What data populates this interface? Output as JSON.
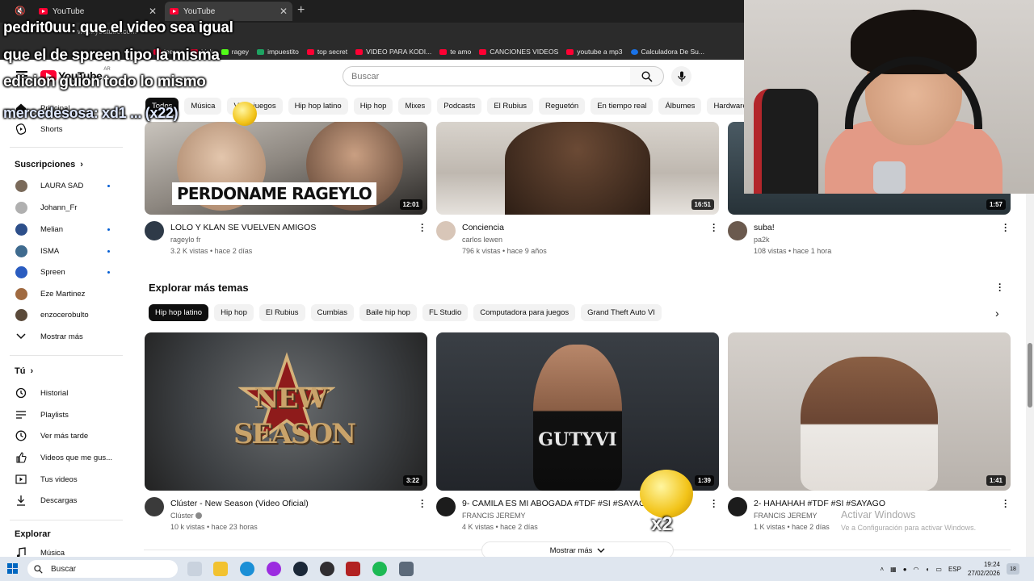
{
  "browser": {
    "tabs": [
      {
        "title": "YouTube"
      },
      {
        "title": "YouTube"
      }
    ],
    "url": "www.youtube.com",
    "bookmarks": [
      "jeeray",
      "kick",
      "ragey",
      "impuestito",
      "top secret",
      "VIDEO PARA KODI...",
      "te amo",
      "CANCIONES VIDEOS",
      "youtube a mp3",
      "Calculadora De Su..."
    ]
  },
  "header": {
    "logo_text": "YouTube",
    "country": "AR",
    "search_placeholder": "Buscar"
  },
  "chips": [
    "Todos",
    "Música",
    "Videojuegos",
    "Hip hop latino",
    "Hip hop",
    "Mixes",
    "Podcasts",
    "El Rubius",
    "Reguetón",
    "En tiempo real",
    "Álbumes",
    "Hardware"
  ],
  "sidebar": {
    "principal": "Principal",
    "shorts": "Shorts",
    "subscriptions_heading": "Suscripciones",
    "subscriptions": [
      {
        "name": "LAURA SAD",
        "new": true,
        "color": "#7a6a5a"
      },
      {
        "name": "Johann_Fr",
        "new": false,
        "color": "#b0b0b0"
      },
      {
        "name": "Melian",
        "new": true,
        "color": "#2d4f8a"
      },
      {
        "name": "ISMA",
        "new": true,
        "color": "#3f6b8f"
      },
      {
        "name": "Spreen",
        "new": true,
        "color": "#2a5cc0"
      },
      {
        "name": "Eze Martinez",
        "new": false,
        "color": "#a06a40"
      },
      {
        "name": "enzocerobulto",
        "new": false,
        "color": "#5a4a3a"
      }
    ],
    "show_more": "Mostrar más",
    "you_heading": "Tú",
    "you_items": [
      "Historial",
      "Playlists",
      "Ver más tarde",
      "Videos que me gus...",
      "Tus videos",
      "Descargas"
    ],
    "explore_heading": "Explorar",
    "explore_items": [
      "Música"
    ]
  },
  "videos_top": [
    {
      "title": "LOLO Y KLAN SE VUELVEN AMIGOS",
      "channel": "rageylo fr",
      "meta": "3.2 K vistas • hace 2 días",
      "duration": "12:01",
      "thumb_text": "PERDONAME RAGEYLO"
    },
    {
      "title": "Conciencia",
      "channel": "carlos lewen",
      "meta": "796 k vistas • hace 9 años",
      "duration": "16:51"
    },
    {
      "title": "suba!",
      "channel": "pa2k",
      "meta": "108 vistas • hace 1 hora",
      "duration": "1:57"
    }
  ],
  "explore_section": {
    "title": "Explorar más temas",
    "chips": [
      "Hip hop latino",
      "Hip hop",
      "El Rubius",
      "Cumbias",
      "Baile hip hop",
      "FL Studio",
      "Computadora para juegos",
      "Grand Theft Auto VI"
    ]
  },
  "videos_bottom": [
    {
      "title": "Clúster - New Season (Video Oficial)",
      "channel": "Clúster",
      "meta": "10 k vistas • hace 23 horas",
      "duration": "3:22",
      "thumb_text": "NEW SEASON"
    },
    {
      "title": "9- CAMILA ES MI ABOGADA #TDF #SI #SAYAGO",
      "channel": "FRANCIS JEREMY",
      "meta": "4 K vistas • hace 2 días",
      "duration": "1:39",
      "thumb_text": "GUTYVI"
    },
    {
      "title": "2- HAHAHAH #TDF #SI #SAYAGO",
      "channel": "FRANCIS JEREMY",
      "meta": "1 K vistas • hace 2 días",
      "duration": "1:41"
    }
  ],
  "show_more_button": "Mostrar más",
  "watermark": {
    "line1": "Activar Windows",
    "line2": "Ve a Configuración para activar Windows."
  },
  "overlay_chat": [
    {
      "text": "pedrit0uu: que el video sea igual"
    },
    {
      "text": "que el de spreen tipo la misma"
    },
    {
      "text": "edicion guion todo lo mismo"
    },
    {
      "text": "mercedesosa: xd1 ... (x22)"
    }
  ],
  "emote_label": "x2",
  "taskbar": {
    "search": "Buscar",
    "lang": "ESP",
    "time": "19:24",
    "date": "27/02/2026",
    "notifications": "18"
  }
}
